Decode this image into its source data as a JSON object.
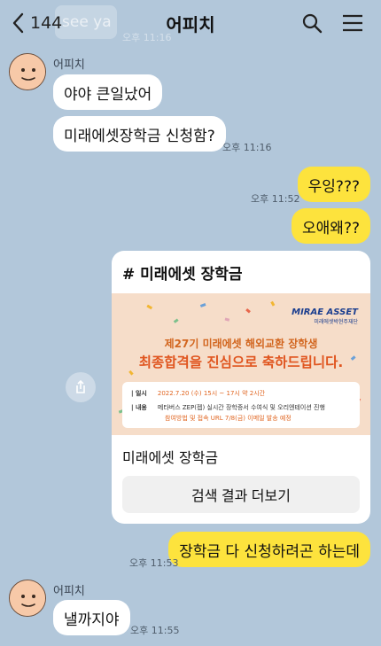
{
  "header": {
    "back_count": "144",
    "title": "어피치",
    "ghost_text": "see ya",
    "ghost_time": "오후 11:16"
  },
  "messages": {
    "m1": "야야 큰일났어",
    "m2": "미래에셋장학금 신청함?",
    "m2_time": "오후 11:16",
    "m3": "우잉???",
    "m4": "오애왜??",
    "m4_time": "오후 11:52",
    "m5": "장학금 다 신청하려곤 하는데",
    "m5_time": "오후 11:53",
    "m6": "낼까지야",
    "m6_time": "오후 11:55"
  },
  "senders": {
    "first": "어피치",
    "second": "어피치"
  },
  "card": {
    "title": "# 미래에셋 장학금",
    "brand": "MIRAE ASSET",
    "brand_sub": "미래에셋박현주재단",
    "headline1": "제27기 미래에셋 해외교환 장학생",
    "headline2": "최종합격을 진심으로 축하드립니다.",
    "info": {
      "date_key": "| 일시",
      "date_val": "2022.7.20 (수) 15시 ~ 17시 약 2시간",
      "content_key": "| 내용",
      "content_val1": "메타버스 ZEP(젭) 실시간 장학증서 수여식 및 오리엔테이션 진행",
      "content_val2": "참여방법 및 접속 URL 7/8(금) 이메일 발송 예정"
    },
    "caption": "미래에셋 장학금",
    "button_label": "검색 결과 더보기"
  },
  "icons": {
    "back": "chevron-left-icon",
    "search": "search-icon",
    "menu": "hamburger-menu-icon",
    "share": "share-icon"
  },
  "colors": {
    "background": "#b2c7da",
    "bubble_in": "#ffffff",
    "bubble_out": "#fde33d",
    "banner_accent": "#e0551f"
  }
}
